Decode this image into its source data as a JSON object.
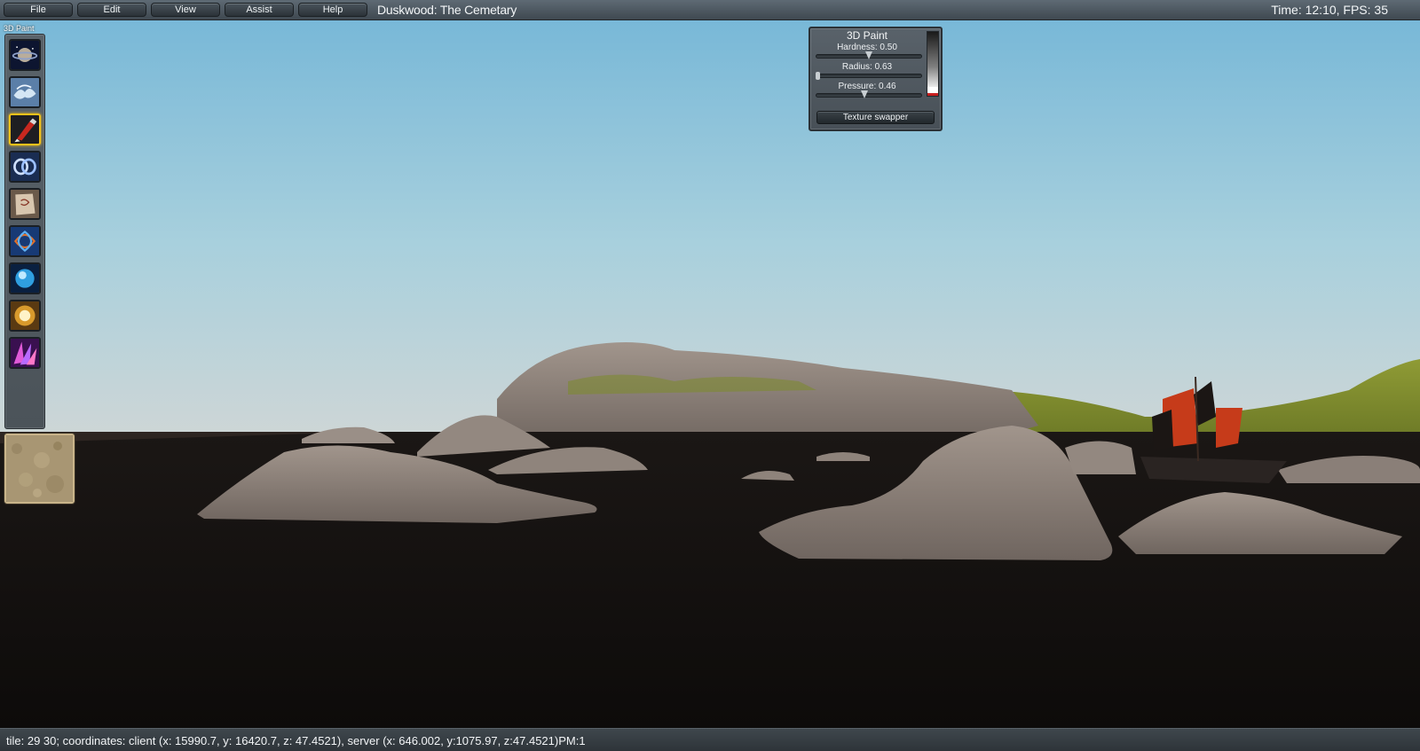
{
  "menubar": {
    "items": [
      {
        "label": "File"
      },
      {
        "label": "Edit"
      },
      {
        "label": "View"
      },
      {
        "label": "Assist"
      },
      {
        "label": "Help"
      }
    ],
    "zone_title": "Duskwood: The Cemetary",
    "time_fps": "Time: 12:10, FPS: 35"
  },
  "palette": {
    "title": "3D Paint",
    "selected_index": 2,
    "tools": [
      {
        "icon": "planet-icon"
      },
      {
        "icon": "water-splash-icon"
      },
      {
        "icon": "paint-brush-icon"
      },
      {
        "icon": "rings-icon"
      },
      {
        "icon": "parchment-icon"
      },
      {
        "icon": "knot-icon"
      },
      {
        "icon": "blue-orb-icon"
      },
      {
        "icon": "light-burst-icon"
      },
      {
        "icon": "purple-spikes-icon"
      }
    ],
    "texture_icon": "sand-texture-icon"
  },
  "paint_panel": {
    "title": "3D Paint",
    "hardness_label": "Hardness: 0.50",
    "hardness": 0.5,
    "radius_label": "Radius: 0.63",
    "radius": 0.0,
    "pressure_label": "Pressure: 0.46",
    "pressure": 0.46,
    "texture_swapper_label": "Texture swapper"
  },
  "statusbar": {
    "text": "tile: 29 30; coordinates: client (x: 15990.7, y: 16420.7, z: 47.4521), server (x: 646.002, y:1075.97, z:47.4521)PM:1"
  },
  "colors": {
    "sky_top": "#7ab9d8",
    "sky_horizon": "#c9d6d8",
    "ground": "#0f0d0c",
    "rock": "#8a7f78",
    "grass": "#7c8a2a",
    "ship_sail": "#c63b1a",
    "selection": "#f4c21a"
  }
}
